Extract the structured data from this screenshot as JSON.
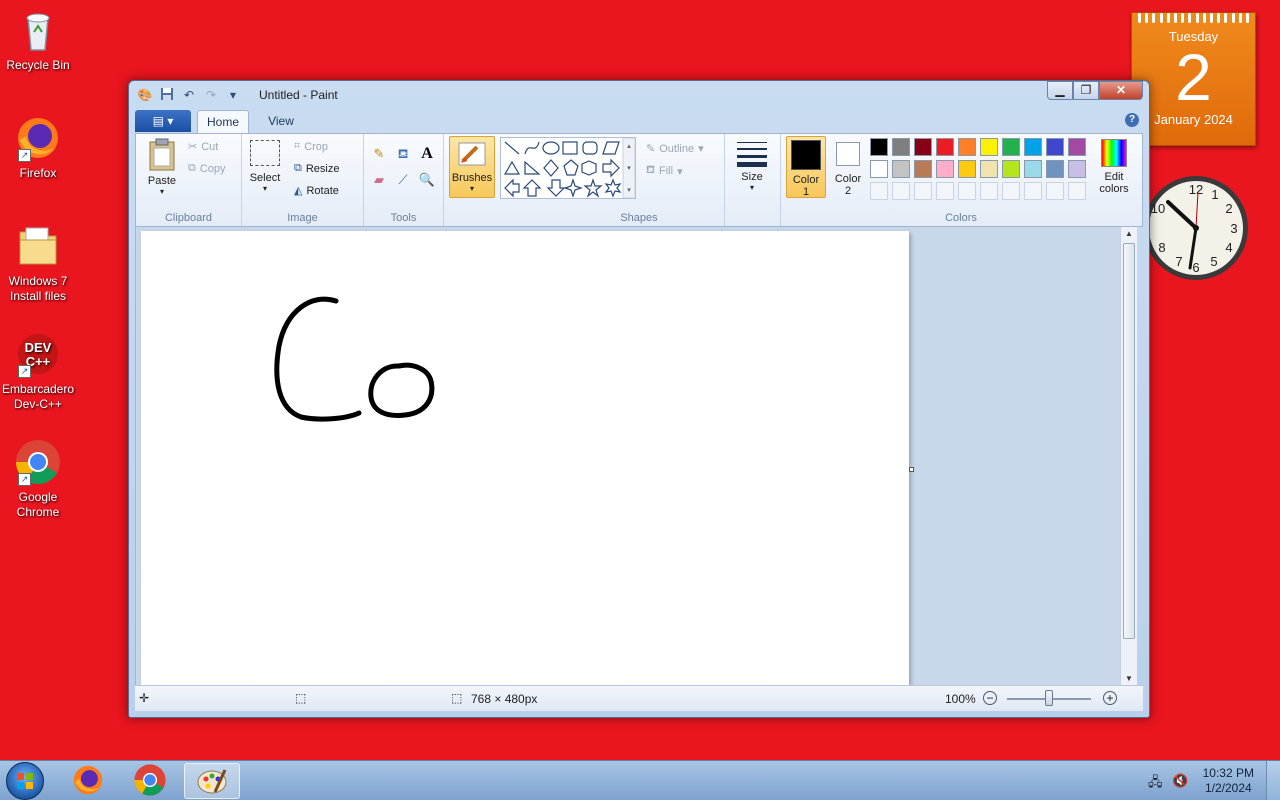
{
  "desktop": {
    "icons": [
      {
        "label": "Recycle Bin",
        "icon": "recycle-bin-icon"
      },
      {
        "label": "Firefox",
        "icon": "firefox-icon"
      },
      {
        "label": "Windows 7 Install files",
        "icon": "folder-icon"
      },
      {
        "label": "Embarcadero Dev-C++",
        "icon": "devcpp-icon",
        "badge": "DEV C++"
      },
      {
        "label": "Google Chrome",
        "icon": "chrome-icon"
      }
    ]
  },
  "calendar": {
    "weekday": "Tuesday",
    "day": "2",
    "month_year": "January 2024"
  },
  "paint": {
    "title": "Untitled - Paint",
    "tabs": {
      "file_icon": "paint-menu-icon",
      "home": "Home",
      "view": "View"
    },
    "clipboard": {
      "paste": "Paste",
      "cut": "Cut",
      "copy": "Copy",
      "group": "Clipboard"
    },
    "image": {
      "select": "Select",
      "crop": "Crop",
      "resize": "Resize",
      "rotate": "Rotate",
      "group": "Image"
    },
    "tools": {
      "group": "Tools"
    },
    "brushes": {
      "label": "Brushes"
    },
    "shapes": {
      "outline": "Outline",
      "fill": "Fill",
      "group": "Shapes"
    },
    "size": {
      "label": "Size"
    },
    "colors": {
      "color1": "Color",
      "color1_num": "1",
      "color2": "Color",
      "color2_num": "2",
      "edit": "Edit",
      "edit2": "colors",
      "group": "Colors",
      "color1_value": "#000000",
      "color2_value": "#ffffff",
      "palette_row1": [
        "#000000",
        "#7f7f7f",
        "#880015",
        "#ed1c24",
        "#ff7f27",
        "#fff200",
        "#22b14c",
        "#00a2e8",
        "#3f48cc",
        "#a349a4"
      ],
      "palette_row2": [
        "#ffffff",
        "#c3c3c3",
        "#b97a57",
        "#ffaec9",
        "#ffc90e",
        "#efe4b0",
        "#b5e61d",
        "#99d9ea",
        "#7092be",
        "#c8bfe7"
      ]
    },
    "status": {
      "dimensions": "768 × 480px",
      "zoom": "100%"
    }
  },
  "taskbar": {
    "time": "10:32 PM",
    "date": "1/2/2024"
  }
}
